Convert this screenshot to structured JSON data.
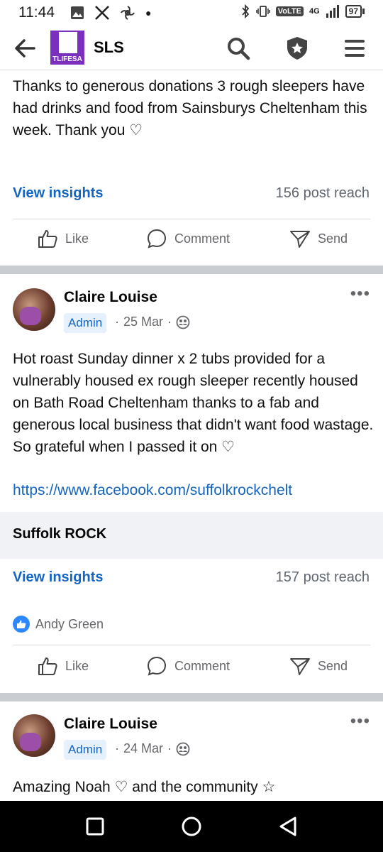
{
  "status_bar": {
    "time": "11:44",
    "network": "4G",
    "volte": "VoLTE",
    "battery": "97"
  },
  "header": {
    "group_name": "SLS",
    "logo_text": "TLIFESA",
    "icons": [
      "back-icon",
      "search-icon",
      "shield-star-icon",
      "menu-icon"
    ]
  },
  "post1": {
    "text": "Thanks to generous donations 3 rough sleepers have had drinks and food from Sainsburys Cheltenham this week. Thank you ♡",
    "insights_label": "View insights",
    "reach": "156 post reach",
    "actions": {
      "like": "Like",
      "comment": "Comment",
      "send": "Send"
    }
  },
  "post2": {
    "author": "Claire Louise",
    "badge": "Admin",
    "date": "25 Mar",
    "text": "Hot roast Sunday dinner x 2 tubs  provided for a vulnerably housed ex rough sleeper recently housed  on Bath Road Cheltenham thanks to a fab and generous local business that didn't want food wastage. So grateful when I passed it on ♡",
    "link": "https://www.facebook.com/suffolkrockchelt",
    "preview_title": "Suffolk ROCK",
    "insights_label": "View insights",
    "reach": "157 post reach",
    "reactor": "Andy Green",
    "actions": {
      "like": "Like",
      "comment": "Comment",
      "send": "Send"
    }
  },
  "post3": {
    "author": "Claire Louise",
    "badge": "Admin",
    "date": "24 Mar",
    "text": "Amazing Noah ♡ and the community ☆"
  },
  "colors": {
    "link": "#1565c0",
    "separator": "#c9ccd1",
    "logo": "#7b2fbf",
    "like_badge": "#2d88ff"
  }
}
